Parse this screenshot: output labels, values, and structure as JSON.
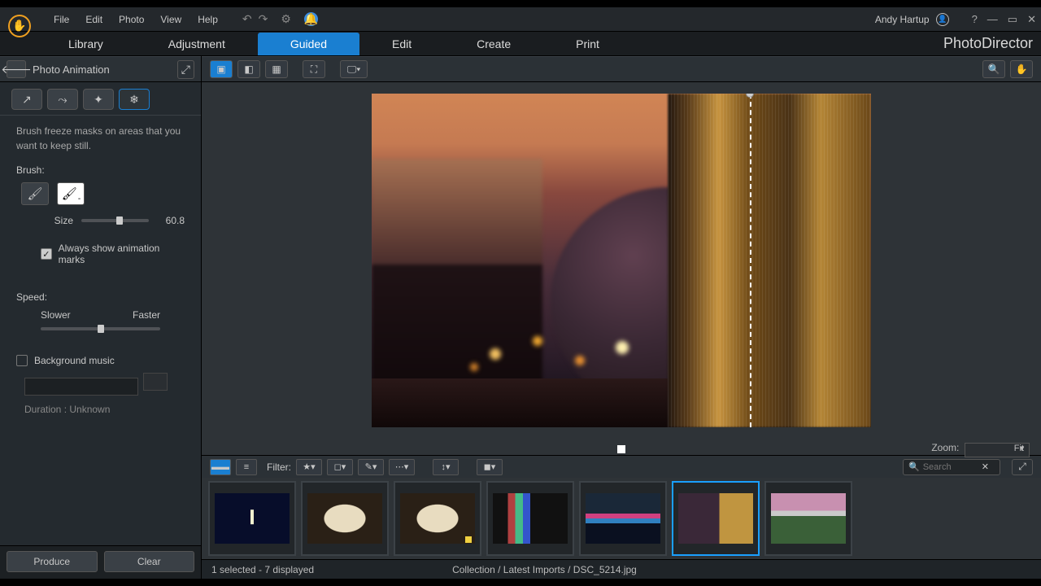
{
  "menu": {
    "file": "File",
    "edit": "Edit",
    "photo": "Photo",
    "view": "View",
    "help": "Help"
  },
  "user": {
    "name": "Andy Hartup"
  },
  "brand": "PhotoDirector",
  "mode_tabs": {
    "library": "Library",
    "adjustment": "Adjustment",
    "guided": "Guided",
    "edit": "Edit",
    "create": "Create",
    "print": "Print"
  },
  "panel": {
    "title": "Photo Animation",
    "instruction": "Brush freeze masks on areas that you want to keep still.",
    "brush_label": "Brush:",
    "size_label": "Size",
    "size_value": "60.8",
    "show_marks_label": "Always show animation marks",
    "speed_label": "Speed:",
    "slower": "Slower",
    "faster": "Faster",
    "bg_music_label": "Background music",
    "duration_label": "Duration : Unknown",
    "produce_btn": "Produce",
    "clear_btn": "Clear"
  },
  "zoom": {
    "label": "Zoom:",
    "value": "Fit"
  },
  "strip": {
    "filter_label": "Filter:",
    "search_placeholder": "Search"
  },
  "status": {
    "selection": "1 selected - 7 displayed",
    "path": "Collection / Latest Imports / DSC_5214.jpg"
  },
  "panel_state": {
    "size_slider_percent": 57,
    "speed_slider_percent": 50,
    "show_marks_checked": true,
    "bg_music_checked": false,
    "active_tool_index": 4
  }
}
